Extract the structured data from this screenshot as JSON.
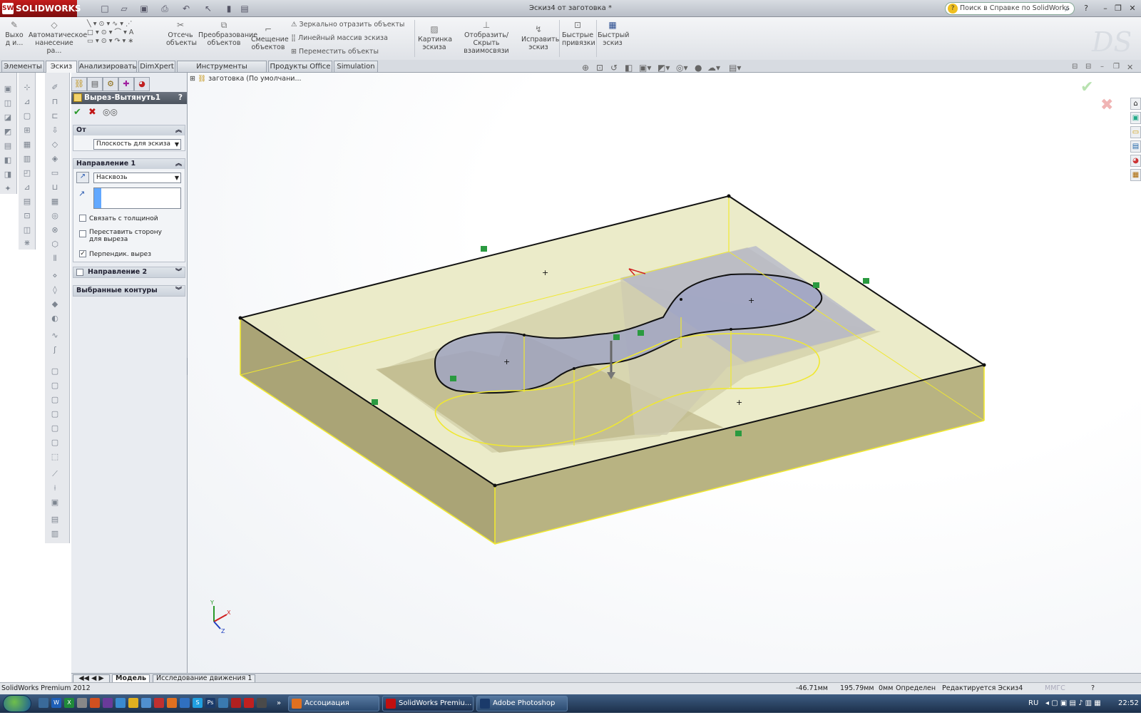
{
  "app": {
    "logo": "SOLIDWORKS",
    "title": "Эскиз4 от заготовка *",
    "search_placeholder": "Поиск в Справке по SolidWorks",
    "help": "?",
    "qa": [
      "□",
      "▱",
      "▣",
      "⎙",
      "↶",
      "↖",
      "▮",
      "▤"
    ]
  },
  "ribbon": {
    "exit": "Выхо\nд и...",
    "autodim": "Автоматическое\nнанесение ра...",
    "trim": "Отсечь\nобъекты",
    "convert": "Преобразование\nобъектов",
    "offset": "Смещение\nобъектов",
    "mirror": "Зеркально отразить объекты",
    "linear": "Линейный массив эскиза",
    "move": "Переместить объекты",
    "picture": "Картинка\nэскиза",
    "show_rel": "Отобразить/Скрыть\nвзаимосвязи",
    "repair": "Исправить\nэскиз",
    "snaps": "Быстрые\nпривязки",
    "rapid": "Быстрый\nэскиз"
  },
  "tabs": [
    "Элементы",
    "Эскиз",
    "Анализировать",
    "DimXpert",
    "Инструменты отрисовки",
    "Продукты Office",
    "Simulation"
  ],
  "pm": {
    "title": "Вырез-Вытянуть1",
    "help": "?",
    "from_label": "От",
    "from_value": "Плоскость для эскиза",
    "dir1_label": "Направление 1",
    "dir1_value": "Насквозь",
    "thickness": "Связать с толщиной",
    "flip": "Переставить сторону для выреза",
    "normal": "Перпендик. вырез",
    "dir2_label": "Направление 2",
    "contours_label": "Выбранные контуры",
    "check_thickness": false,
    "check_flip": false,
    "check_normal": true
  },
  "tree": {
    "root": "заготовка  (По умолчани..."
  },
  "bottom_tabs": [
    "Модель",
    "Исследование движения 1"
  ],
  "status": {
    "product": "SolidWorks Premium 2012",
    "x": "-46.71мм",
    "y": "195.79мм",
    "z": "0мм",
    "state": "Определен",
    "mode": "Редактируется Эскиз4",
    "units": "ММГС",
    "help": "?"
  },
  "taskbar": {
    "items": [
      "Ассоциация Экспе...",
      "SolidWorks Premiu...",
      "Adobe Photoshop"
    ],
    "lang": "RU",
    "time": "22:52",
    "chev": "»"
  },
  "triad": {
    "x": "X",
    "y": "Y",
    "z": "Z"
  },
  "colors": {
    "accent": "#b01010",
    "sketch": "#f0e830",
    "part": "#b7b27b"
  }
}
